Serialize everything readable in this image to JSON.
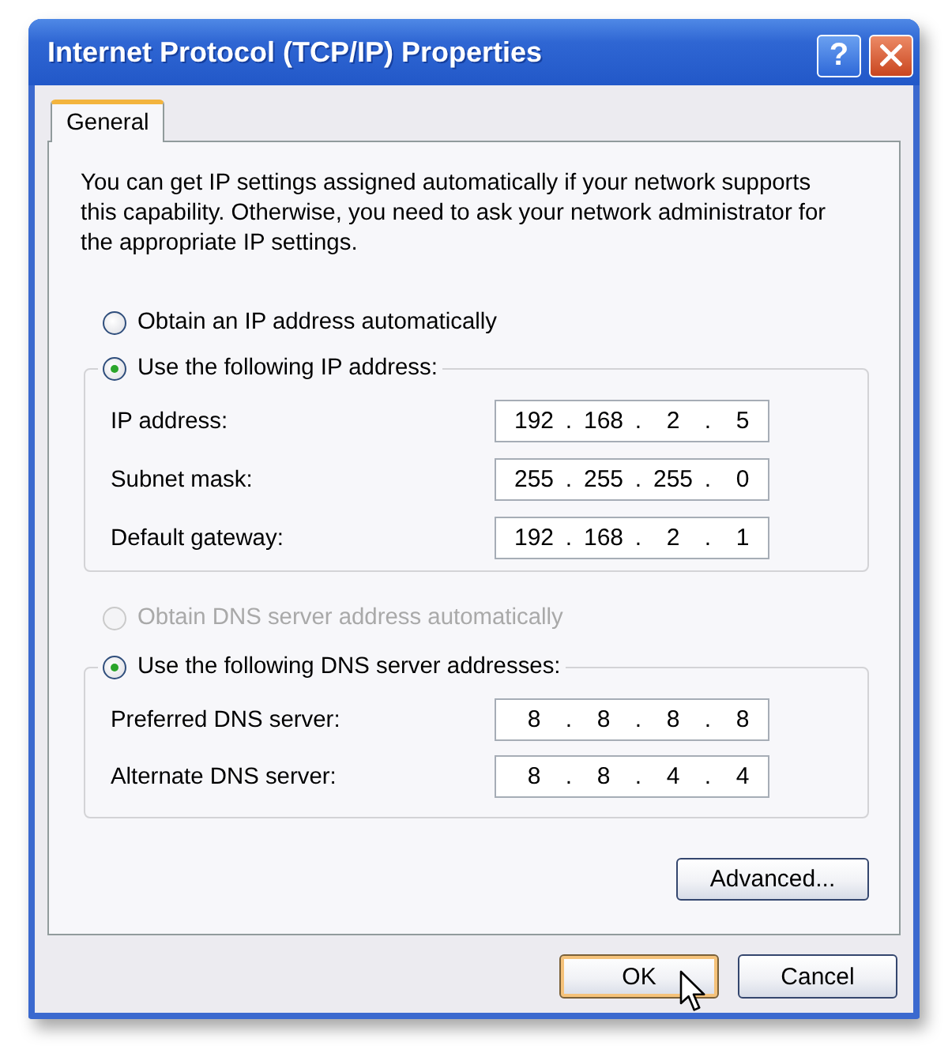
{
  "window": {
    "title": "Internet Protocol (TCP/IP) Properties",
    "title_buttons": [
      {
        "kind": "help",
        "label": "?"
      },
      {
        "kind": "close"
      }
    ]
  },
  "tabs": [
    {
      "label": "General",
      "selected": true
    }
  ],
  "description": "You can get IP settings assigned automatically if your network supports this capability. Otherwise, you need to ask your network administrator for the appropriate IP settings.",
  "ip_section": {
    "options": [
      {
        "label": "Obtain an IP address automatically",
        "selected": false,
        "disabled": false
      },
      {
        "label": "Use the following IP address:",
        "selected": true,
        "disabled": false
      }
    ],
    "fields": [
      {
        "label": "IP address:",
        "value": "192 . 168 . 2 . 5"
      },
      {
        "label": "Subnet mask:",
        "value": "255 . 255 . 255 . 0"
      },
      {
        "label": "Default gateway:",
        "value": "192 . 168 . 2 . 1"
      }
    ]
  },
  "dns_section": {
    "options": [
      {
        "label": "Obtain DNS server address automatically",
        "selected": false,
        "disabled": true
      },
      {
        "label": "Use the following DNS server addresses:",
        "selected": true,
        "disabled": false
      }
    ],
    "fields": [
      {
        "label": "Preferred DNS server:",
        "value": "8 . 8 . 8 . 8"
      },
      {
        "label": "Alternate DNS server:",
        "value": "8 . 8 . 4 . 4"
      }
    ]
  },
  "advanced_button": {
    "label": "Advanced..."
  },
  "buttons": [
    {
      "label": "OK",
      "hovered": true
    },
    {
      "label": "Cancel",
      "hovered": false
    }
  ]
}
